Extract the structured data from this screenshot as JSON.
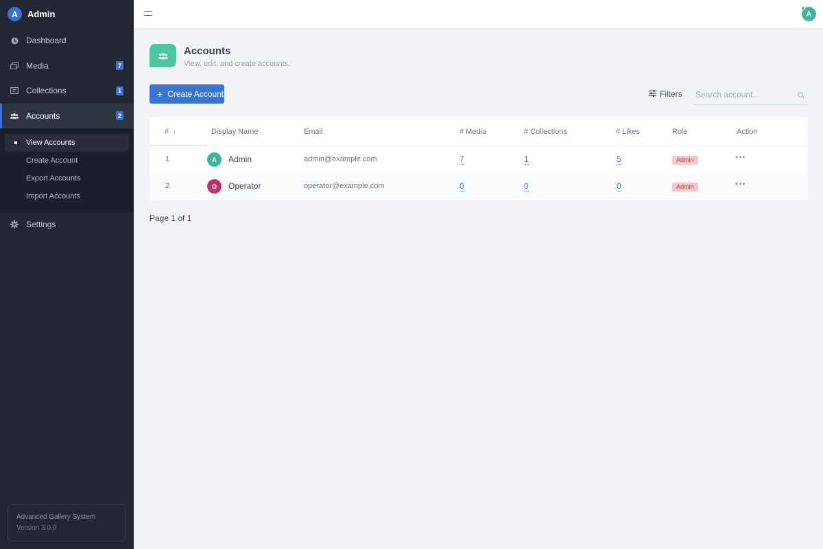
{
  "app": {
    "brand_initial": "A",
    "brand_name": "Admin",
    "footer_title": "Advanced Gallery System",
    "footer_version": "Version 3.0.0"
  },
  "sidebar": {
    "items": [
      {
        "label": "Dashboard",
        "icon": "dashboard-icon",
        "badge": null
      },
      {
        "label": "Media",
        "icon": "media-icon",
        "badge": "7"
      },
      {
        "label": "Collections",
        "icon": "collections-icon",
        "badge": "1"
      },
      {
        "label": "Accounts",
        "icon": "users-icon",
        "badge": "2"
      },
      {
        "label": "Settings",
        "icon": "gear-icon",
        "badge": null
      }
    ],
    "subitems": [
      {
        "label": "View Accounts"
      },
      {
        "label": "Create Account"
      },
      {
        "label": "Export Accounts"
      },
      {
        "label": "Import Accounts"
      }
    ]
  },
  "topbar": {
    "user_initial": "A"
  },
  "page": {
    "title": "Accounts",
    "subtitle": "View, edit, and create accounts.",
    "create_button": "Create Account",
    "filters_label": "Filters",
    "search_placeholder": "Search account..."
  },
  "table": {
    "columns": [
      "#",
      "Display Name",
      "Email",
      "# Media",
      "# Collections",
      "# Likes",
      "Role",
      "Action"
    ],
    "rows": [
      {
        "id": "1",
        "initial": "A",
        "name": "Admin",
        "email": "admin@example.com",
        "media": "7",
        "collections": "1",
        "likes": "5",
        "role": "Admin",
        "avatar_color": "#3fb59d"
      },
      {
        "id": "2",
        "initial": "O",
        "name": "Operator",
        "email": "operator@example.com",
        "media": "0",
        "collections": "0",
        "likes": "0",
        "role": "Admin",
        "avatar_color": "#b8356b"
      }
    ]
  },
  "pagination": {
    "text": "Page 1 of 1"
  },
  "colors": {
    "accent": "#3a74d1",
    "sidebar_bg": "#232733",
    "page_icon": "#4cc79c",
    "role_badge_bg": "#f5c9cb",
    "role_badge_text": "#c0393f"
  }
}
